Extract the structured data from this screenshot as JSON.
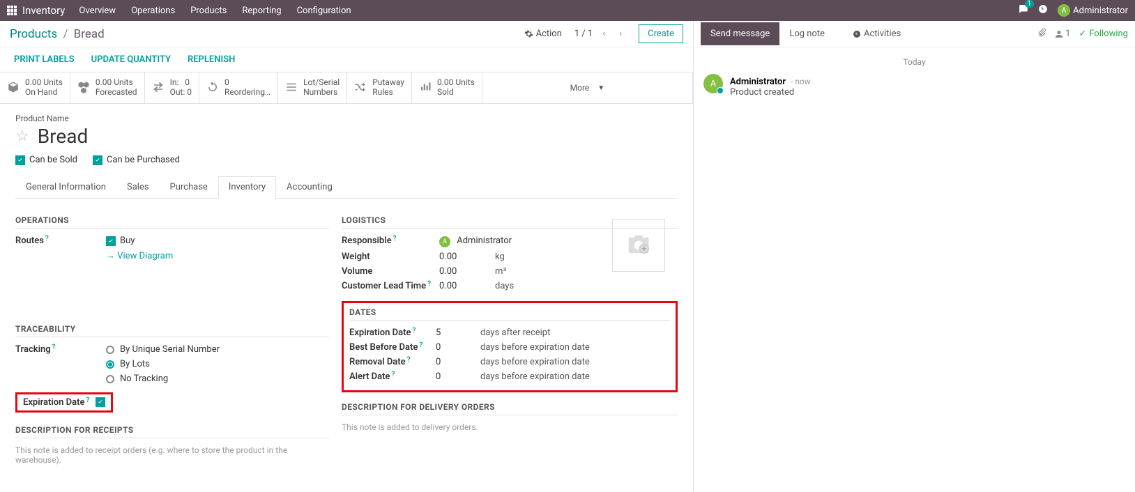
{
  "nav": {
    "app": "Inventory",
    "menu": [
      "Overview",
      "Operations",
      "Products",
      "Reporting",
      "Configuration"
    ],
    "chat_count": "1",
    "user": "Administrator",
    "user_initial": "A"
  },
  "breadcrumb": {
    "parent": "Products",
    "current": "Bread"
  },
  "actions": {
    "action_label": "Action",
    "pager": "1 / 1",
    "create": "Create"
  },
  "toolbar": [
    "PRINT LABELS",
    "UPDATE QUANTITY",
    "REPLENISH"
  ],
  "stats": {
    "onhand": {
      "qty": "0.00 Units",
      "label": "On Hand"
    },
    "forecasted": {
      "qty": "0.00 Units",
      "label": "Forecasted"
    },
    "inout": {
      "in_l": "In:",
      "in_v": "0",
      "out_l": "Out:",
      "out_v": "0"
    },
    "reorder": {
      "qty": "0",
      "label": "Reordering…"
    },
    "lot": {
      "l1": "Lot/Serial",
      "l2": "Numbers"
    },
    "putaway": {
      "l1": "Putaway",
      "l2": "Rules"
    },
    "sold": {
      "qty": "0.00 Units",
      "label": "Sold"
    },
    "more": "More"
  },
  "product": {
    "name_label": "Product Name",
    "name": "Bread",
    "can_be_sold": "Can be Sold",
    "can_be_purchased": "Can be Purchased"
  },
  "tabs": [
    "General Information",
    "Sales",
    "Purchase",
    "Inventory",
    "Accounting"
  ],
  "inventory": {
    "operations": {
      "title": "OPERATIONS",
      "routes_lbl": "Routes",
      "buy": "Buy",
      "view_diagram": "View Diagram"
    },
    "traceability": {
      "title": "TRACEABILITY",
      "tracking_lbl": "Tracking",
      "opt1": "By Unique Serial Number",
      "opt2": "By Lots",
      "opt3": "No Tracking",
      "exp_lbl": "Expiration Date"
    },
    "logistics": {
      "title": "LOGISTICS",
      "responsible_lbl": "Responsible",
      "responsible_val": "Administrator",
      "responsible_initial": "A",
      "weight_lbl": "Weight",
      "weight_val": "0.00",
      "weight_u": "kg",
      "volume_lbl": "Volume",
      "volume_val": "0.00",
      "volume_u": "m³",
      "lead_lbl": "Customer Lead Time",
      "lead_val": "0.00",
      "lead_u": "days"
    },
    "dates": {
      "title": "DATES",
      "exp_lbl": "Expiration Date",
      "exp_val": "5",
      "exp_u": "days after receipt",
      "bb_lbl": "Best Before Date",
      "bb_val": "0",
      "bb_u": "days before expiration date",
      "rm_lbl": "Removal Date",
      "rm_val": "0",
      "rm_u": "days before expiration date",
      "al_lbl": "Alert Date",
      "al_val": "0",
      "al_u": "days before expiration date"
    },
    "desc_receipts": {
      "title": "DESCRIPTION FOR RECEIPTS",
      "hint": "This note is added to receipt orders (e.g. where to store the product in the warehouse)."
    },
    "desc_delivery": {
      "title": "DESCRIPTION FOR DELIVERY ORDERS",
      "hint": "This note is added to delivery orders."
    }
  },
  "chatter": {
    "send": "Send message",
    "lognote": "Log note",
    "activities": "Activities",
    "followers": "1",
    "following": "Following",
    "today": "Today",
    "entry": {
      "who": "Administrator",
      "initial": "A",
      "when": "now",
      "msg": "Product created"
    }
  }
}
